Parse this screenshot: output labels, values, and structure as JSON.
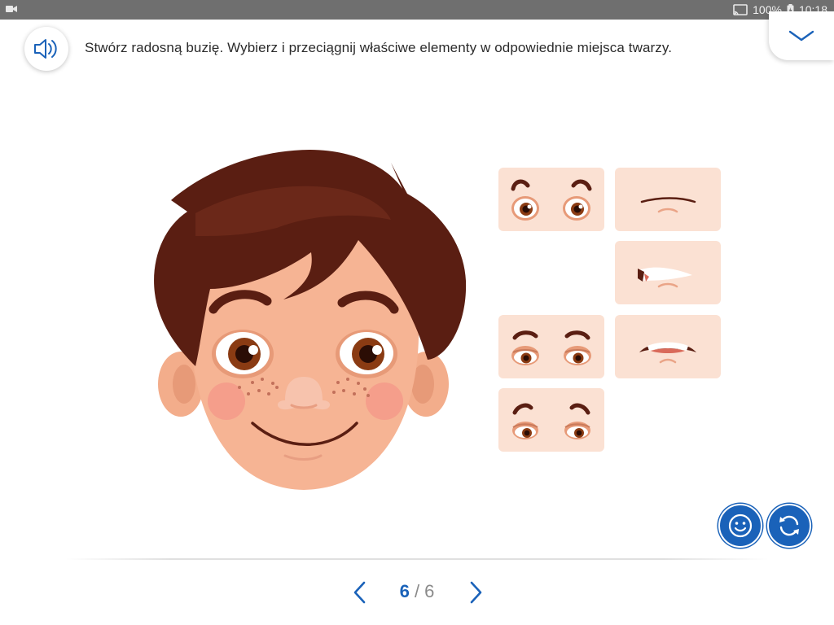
{
  "status_bar": {
    "battery": "100%",
    "time": "10:18",
    "icons": [
      "video-icon",
      "cast-icon",
      "battery-icon"
    ]
  },
  "header": {
    "instruction": "Stwórz radosną buzię. Wybierz i przeciągnij właściwe elementy w odpowiednie miejsca twarzy.",
    "speaker_icon": "speaker-icon",
    "collapse_icon": "chevron-down-icon"
  },
  "pieces": [
    {
      "kind": "eyes",
      "variant": "surprised"
    },
    {
      "kind": "mouth",
      "variant": "flat"
    },
    {
      "kind": "mouth",
      "variant": "smirk"
    },
    {
      "kind": "eyes",
      "variant": "sleepy"
    },
    {
      "kind": "mouth",
      "variant": "frown-teeth"
    },
    {
      "kind": "eyes",
      "variant": "sad"
    }
  ],
  "actions": {
    "check_icon": "smiley-icon",
    "reset_icon": "refresh-icon"
  },
  "pager": {
    "current": "6",
    "separator": " / ",
    "total": "6"
  },
  "colors": {
    "accent": "#1a62b9",
    "tile_bg": "#fbe1d3",
    "skin": "#f6b494",
    "hair": "#5a1e12",
    "status_bar": "#6f6f6f"
  }
}
